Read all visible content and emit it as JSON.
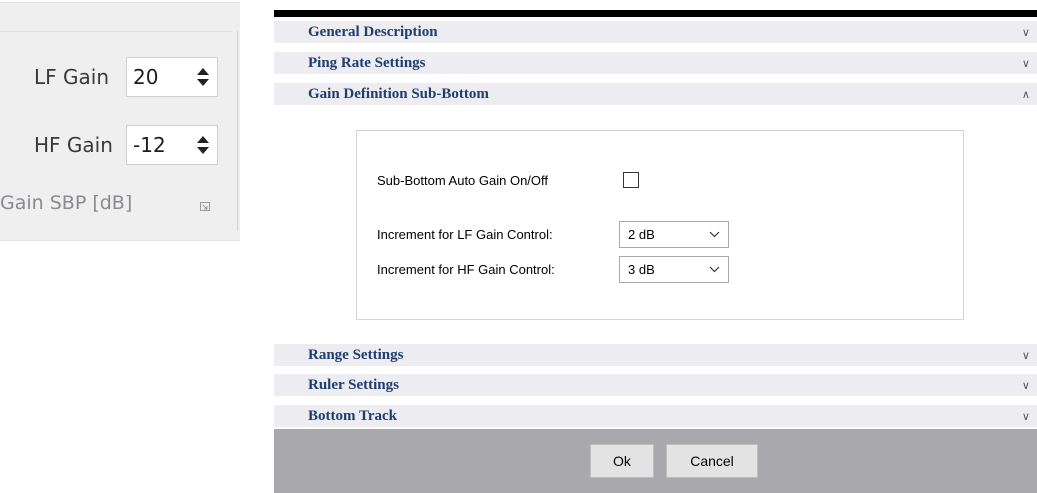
{
  "ribbon": {
    "lf_label": "LF Gain",
    "lf_value": "20",
    "hf_label": "HF Gain",
    "hf_value": "-12",
    "group_label": "Gain SBP [dB]"
  },
  "dialog": {
    "sections_top": [
      {
        "title": "General Description",
        "state": "collapsed"
      },
      {
        "title": "Ping Rate Settings",
        "state": "collapsed"
      },
      {
        "title": "Gain Definition Sub-Bottom",
        "state": "expanded"
      }
    ],
    "sub_bottom": {
      "auto_gain_label": "Sub-Bottom Auto Gain On/Off",
      "auto_gain_checked": false,
      "lf_increment_label": "Increment for LF Gain Control:",
      "lf_increment_value": "2 dB",
      "hf_increment_label": "Increment for HF Gain Control:",
      "hf_increment_value": "3 dB"
    },
    "sections_bottom": [
      {
        "title": "Range Settings",
        "state": "collapsed"
      },
      {
        "title": "Ruler Settings",
        "state": "collapsed"
      },
      {
        "title": "Bottom Track",
        "state": "collapsed"
      }
    ],
    "buttons": {
      "ok": "Ok",
      "cancel": "Cancel"
    },
    "icons": {
      "collapsed": "double-chevron-down-icon",
      "expanded": "double-chevron-up-icon"
    },
    "colors": {
      "section_title": "#1f3d6e",
      "section_bg": "#ececf1",
      "footer_bg": "#a9a9ad"
    }
  }
}
